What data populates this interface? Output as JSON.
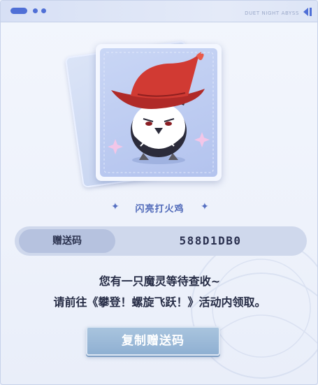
{
  "window": {
    "brand_text": "DUET NIGHT ABYSS",
    "close_icon": "chevron-left-icon"
  },
  "pet": {
    "name": "闪亮打火鸡",
    "illustration": "chicken-with-red-witch-hat",
    "sparkle_icon": "four-point-star-icon"
  },
  "gift_code": {
    "label": "赠送码",
    "value": "588D1DB0"
  },
  "message": {
    "line1": "您有一只魔灵等待查收~",
    "line2": "请前往《攀登！螺旋飞跃！》活动内领取。"
  },
  "copy_button": {
    "label": "复制赠送码"
  },
  "colors": {
    "accent": "#4f6fd6",
    "button": "#9bb8d8",
    "code_bg": "#cfd8ec",
    "hat": "#c8322d"
  }
}
